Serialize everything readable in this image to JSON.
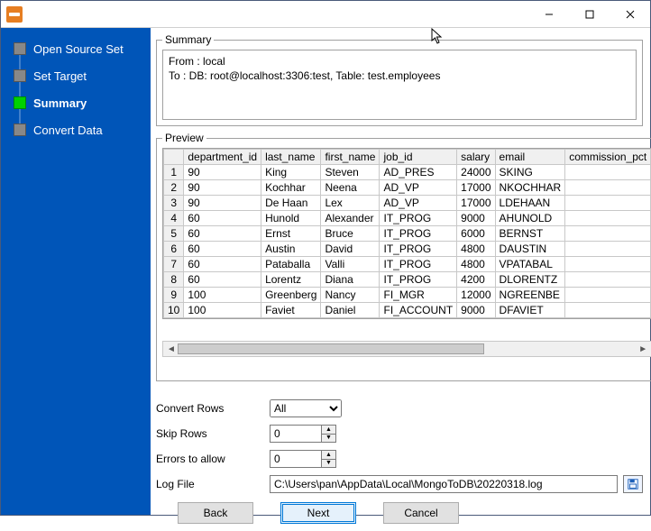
{
  "sidebar": {
    "items": [
      {
        "label": "Open Source Set"
      },
      {
        "label": "Set Target"
      },
      {
        "label": "Summary"
      },
      {
        "label": "Convert Data"
      }
    ],
    "active_index": 2
  },
  "summary": {
    "legend": "Summary",
    "text": "From : local\nTo : DB: root@localhost:3306:test, Table: test.employees"
  },
  "preview": {
    "legend": "Preview",
    "columns": [
      "department_id",
      "last_name",
      "first_name",
      "job_id",
      "salary",
      "email",
      "commission_pct"
    ],
    "rows": [
      [
        "90",
        "King",
        "Steven",
        "AD_PRES",
        "24000",
        "SKING",
        ""
      ],
      [
        "90",
        "Kochhar",
        "Neena",
        "AD_VP",
        "17000",
        "NKOCHHAR",
        ""
      ],
      [
        "90",
        "De Haan",
        "Lex",
        "AD_VP",
        "17000",
        "LDEHAAN",
        ""
      ],
      [
        "60",
        "Hunold",
        "Alexander",
        "IT_PROG",
        "9000",
        "AHUNOLD",
        ""
      ],
      [
        "60",
        "Ernst",
        "Bruce",
        "IT_PROG",
        "6000",
        "BERNST",
        ""
      ],
      [
        "60",
        "Austin",
        "David",
        "IT_PROG",
        "4800",
        "DAUSTIN",
        ""
      ],
      [
        "60",
        "Pataballa",
        "Valli",
        "IT_PROG",
        "4800",
        "VPATABAL",
        ""
      ],
      [
        "60",
        "Lorentz",
        "Diana",
        "IT_PROG",
        "4200",
        "DLORENTZ",
        ""
      ],
      [
        "100",
        "Greenberg",
        "Nancy",
        "FI_MGR",
        "12000",
        "NGREENBE",
        ""
      ],
      [
        "100",
        "Faviet",
        "Daniel",
        "FI_ACCOUNT",
        "9000",
        "DFAVIET",
        ""
      ]
    ]
  },
  "form": {
    "convert_rows_label": "Convert Rows",
    "convert_rows_value": "All",
    "skip_rows_label": "Skip Rows",
    "skip_rows_value": "0",
    "errors_label": "Errors to allow",
    "errors_value": "0",
    "log_label": "Log File",
    "log_value": "C:\\Users\\pan\\AppData\\Local\\MongoToDB\\20220318.log"
  },
  "buttons": {
    "back": "Back",
    "next": "Next",
    "cancel": "Cancel"
  }
}
